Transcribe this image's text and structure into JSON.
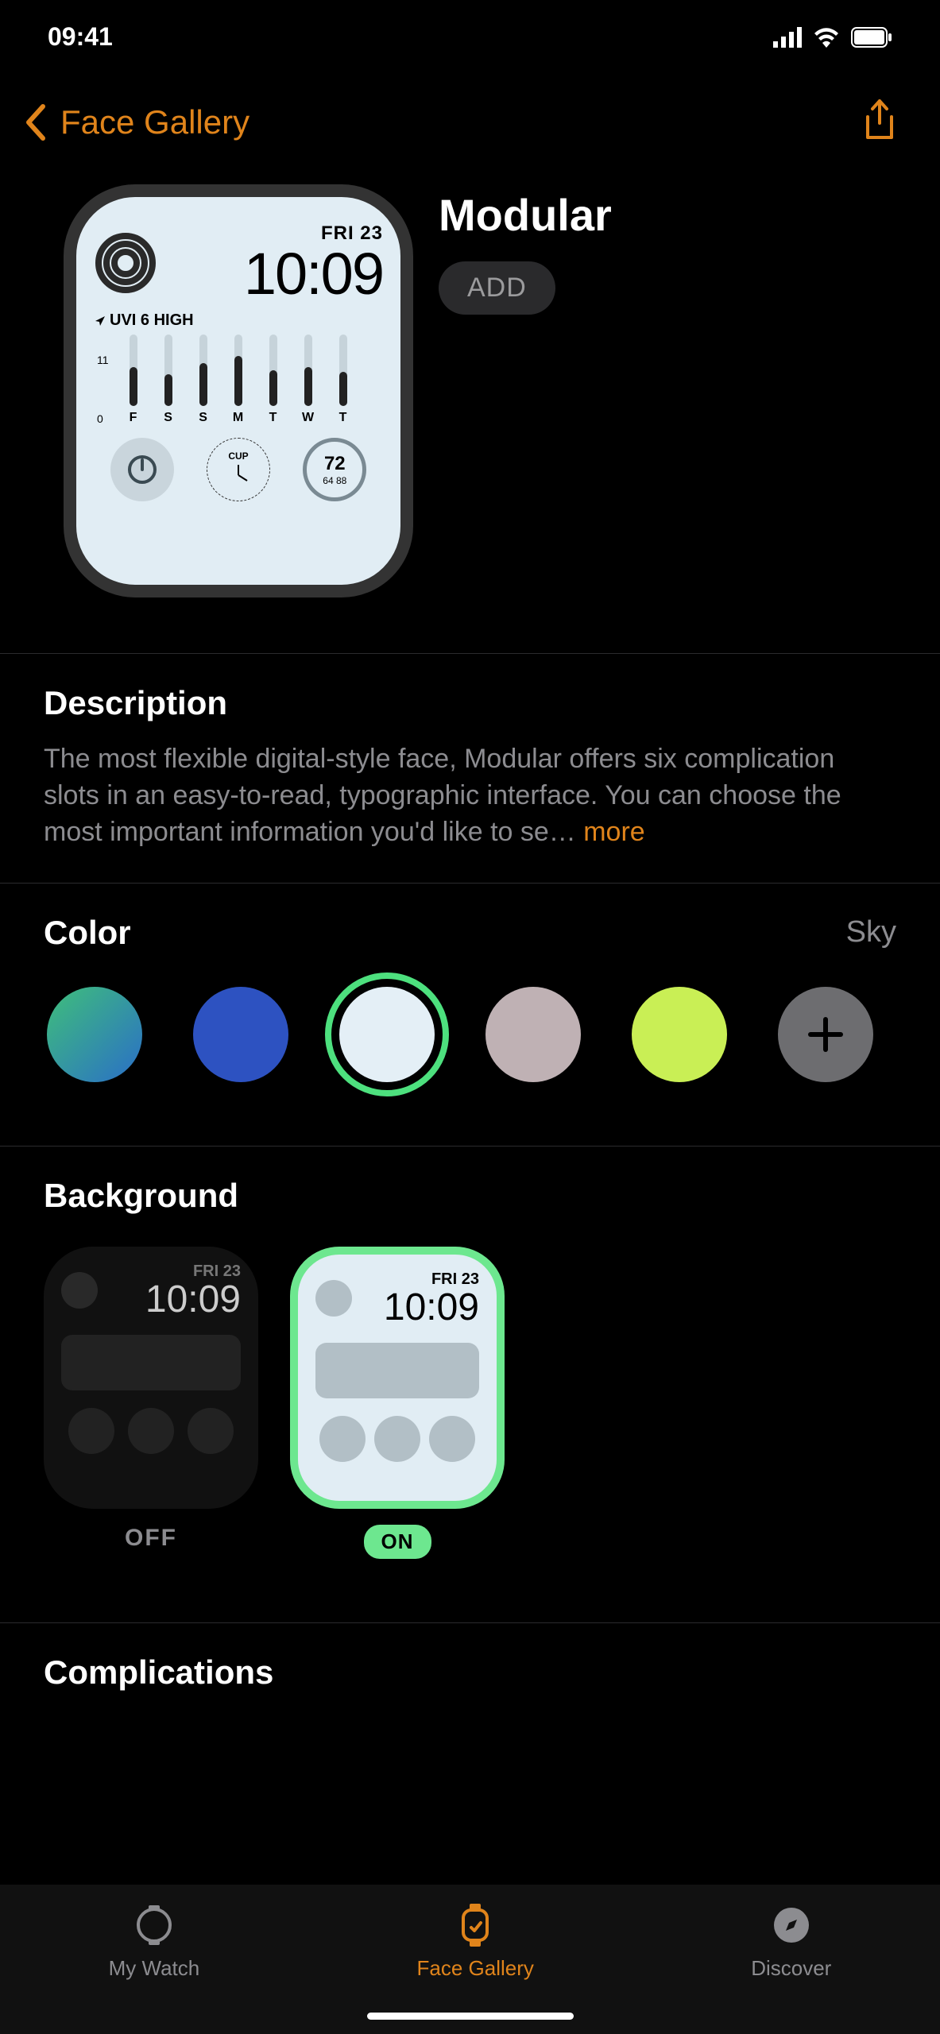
{
  "status": {
    "time": "09:41"
  },
  "nav": {
    "back_label": "Face Gallery"
  },
  "face": {
    "title": "Modular",
    "add_label": "ADD",
    "preview": {
      "date": "FRI 23",
      "time": "10:09",
      "uvi_label": "UVI 6 HIGH",
      "scale_hi": "11",
      "scale_lo": "0",
      "days": [
        "F",
        "S",
        "S",
        "M",
        "T",
        "W",
        "T"
      ],
      "cup_label": "CUP",
      "temp": "72",
      "temp_range": "64  88"
    }
  },
  "description": {
    "heading": "Description",
    "body": "The most flexible digital-style face, Modular offers six complication slots in an easy-to-read, typographic interface. You can choose the most important information you'd like to se…",
    "more": "more"
  },
  "color": {
    "heading": "Color",
    "selected_name": "Sky",
    "swatches": [
      "gradient-teal",
      "royal-blue",
      "sky",
      "mauve",
      "lime",
      "add"
    ]
  },
  "background": {
    "heading": "Background",
    "off_label": "OFF",
    "on_label": "ON",
    "card_date": "FRI 23",
    "card_time": "10:09"
  },
  "complications": {
    "heading": "Complications"
  },
  "tabs": {
    "my_watch": "My Watch",
    "face_gallery": "Face Gallery",
    "discover": "Discover"
  }
}
